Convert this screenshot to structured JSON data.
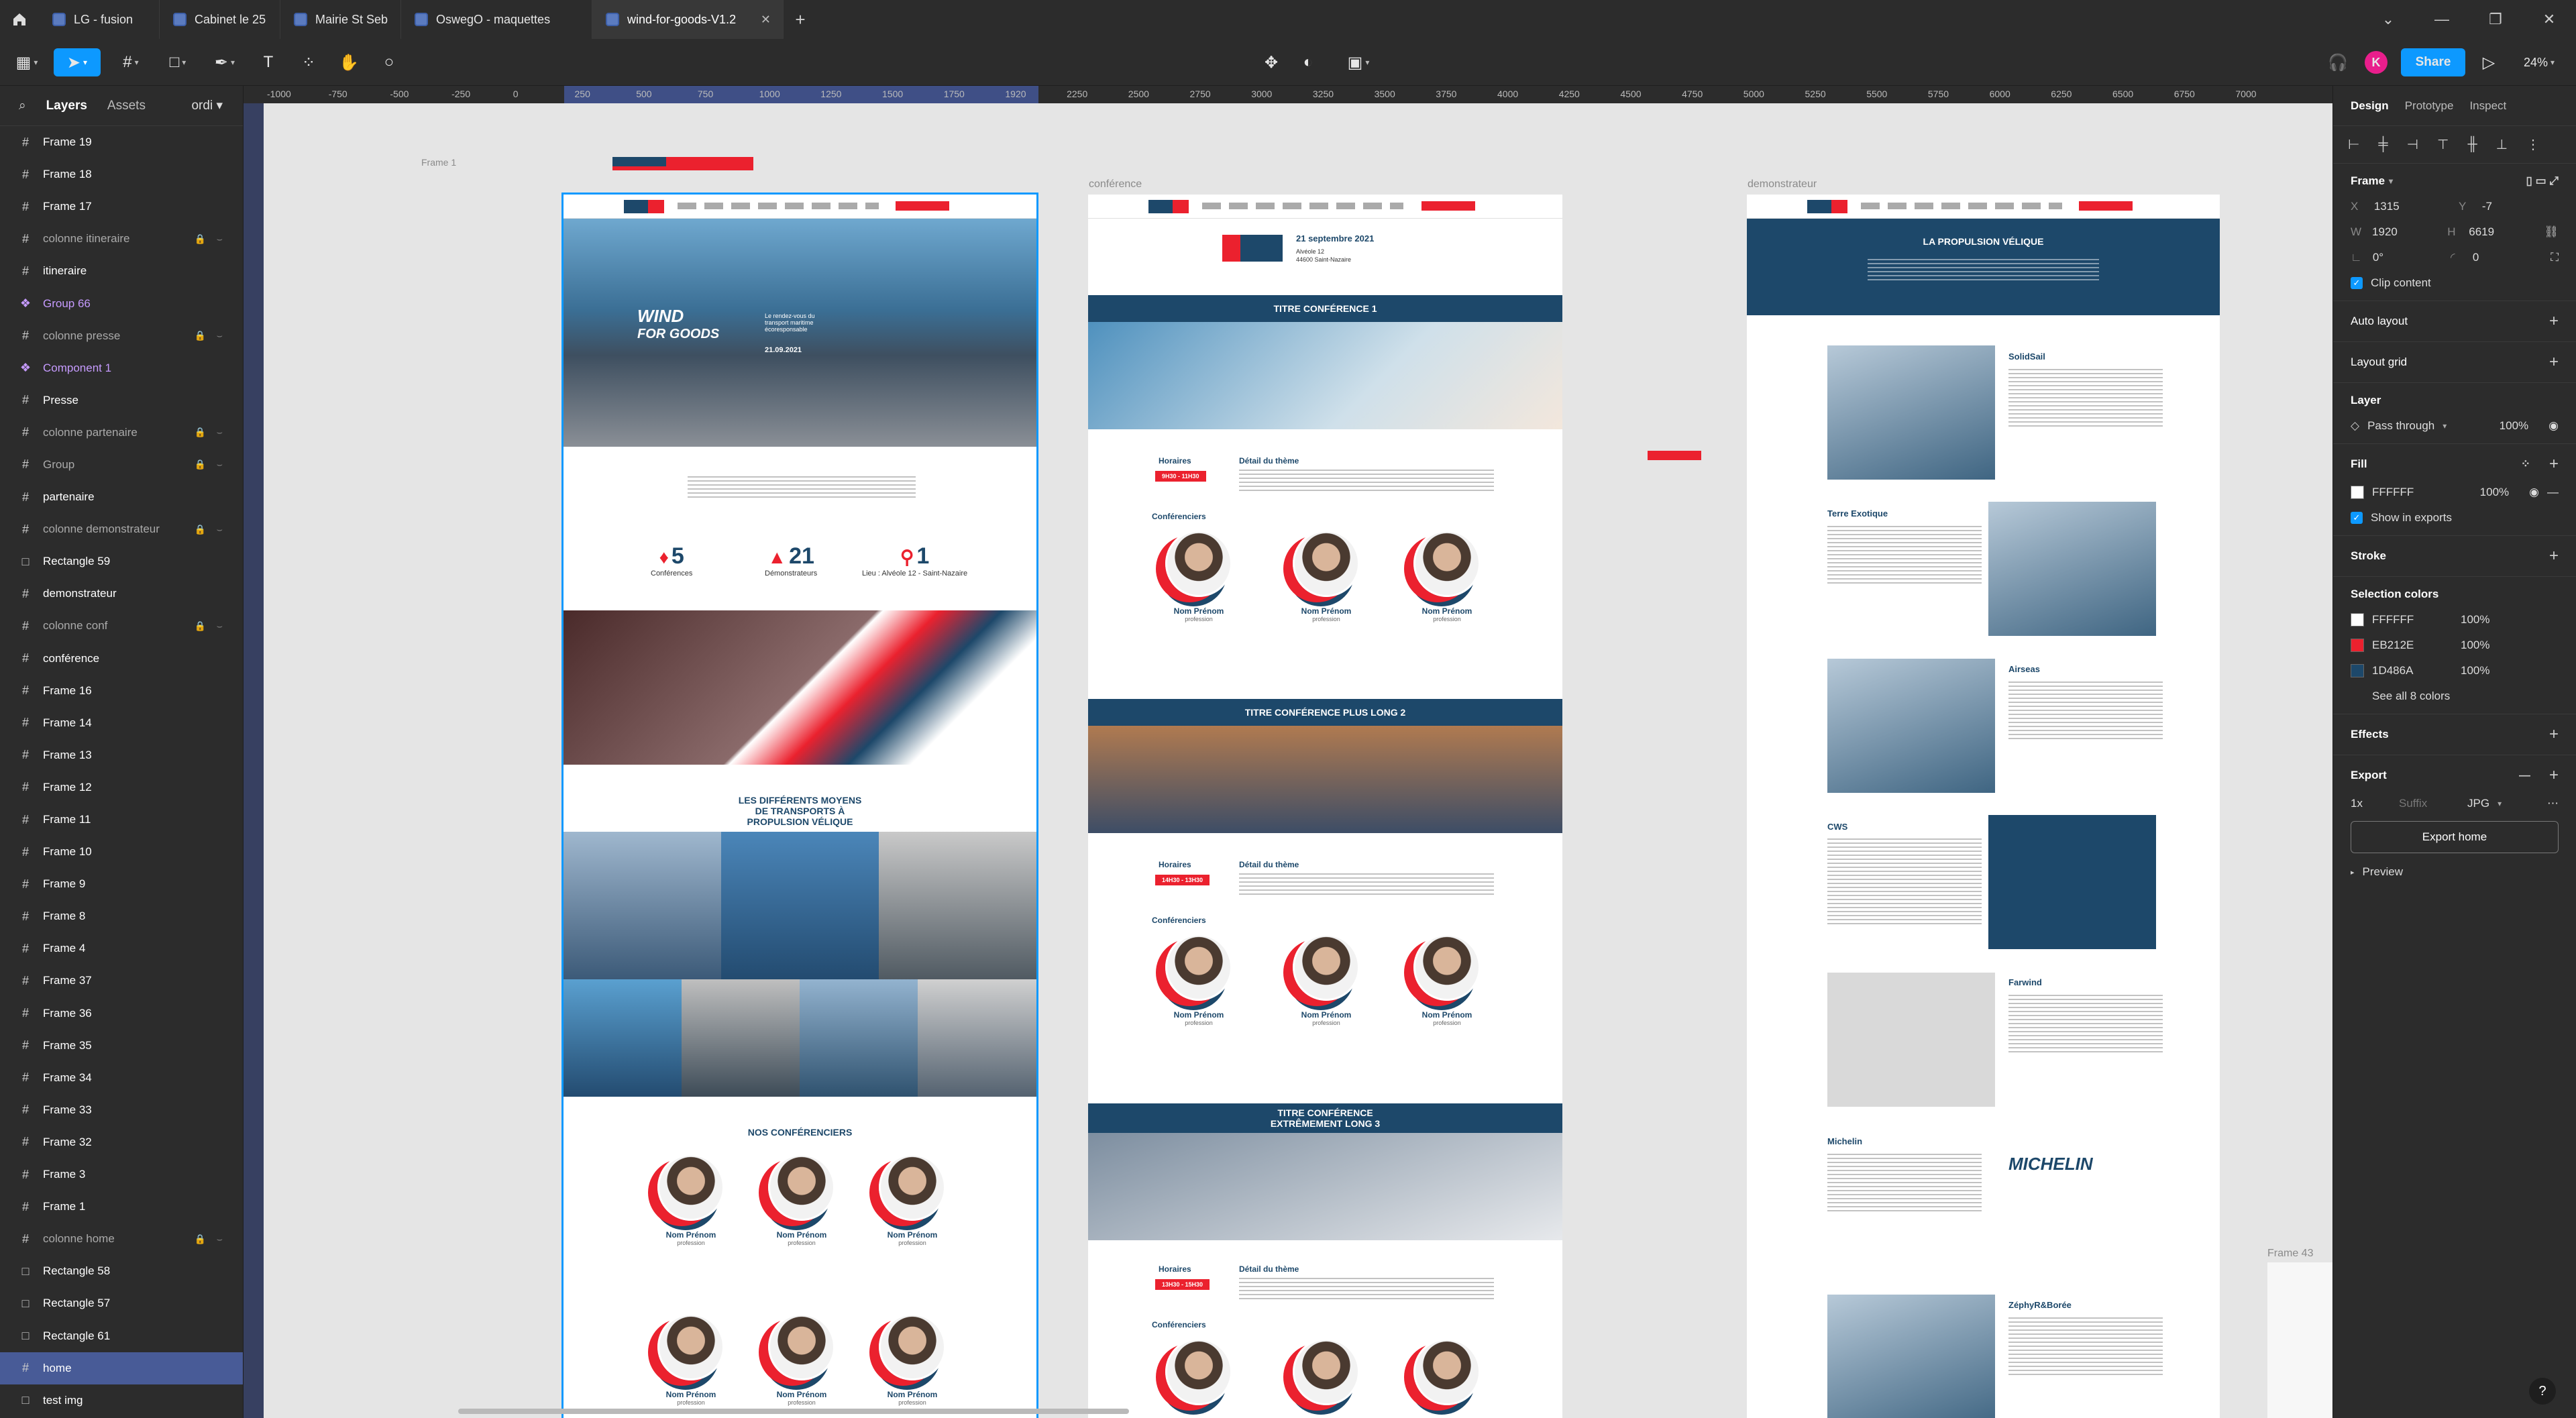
{
  "tabs": [
    {
      "label": "LG - fusion"
    },
    {
      "label": "Cabinet le 25"
    },
    {
      "label": "Mairie St Seb"
    },
    {
      "label": "OswegO - maquettes"
    },
    {
      "label": "wind-for-goods-V1.2"
    }
  ],
  "toolbar": {
    "zoom": "24%",
    "share_label": "Share",
    "avatar_initial": "K"
  },
  "left_panel": {
    "tab_layers": "Layers",
    "tab_assets": "Assets",
    "page": "ordi",
    "layers": [
      {
        "label": "Frame 19",
        "icon": "frame-icon",
        "state": "normal"
      },
      {
        "label": "Frame 18",
        "icon": "frame-icon",
        "state": "normal"
      },
      {
        "label": "Frame 17",
        "icon": "frame-icon",
        "state": "normal"
      },
      {
        "label": "colonne itineraire",
        "icon": "frame-icon",
        "state": "hidden"
      },
      {
        "label": "itineraire",
        "icon": "frame-icon",
        "state": "normal"
      },
      {
        "label": "Group 66",
        "icon": "component-icon",
        "state": "component"
      },
      {
        "label": "colonne presse",
        "icon": "frame-icon",
        "state": "hidden"
      },
      {
        "label": "Component 1",
        "icon": "component-icon",
        "state": "component"
      },
      {
        "label": "Presse",
        "icon": "frame-icon",
        "state": "normal"
      },
      {
        "label": "colonne partenaire",
        "icon": "frame-icon",
        "state": "hidden"
      },
      {
        "label": "Group",
        "icon": "frame-icon",
        "state": "hidden"
      },
      {
        "label": "partenaire",
        "icon": "frame-icon",
        "state": "normal"
      },
      {
        "label": "colonne demonstrateur",
        "icon": "frame-icon",
        "state": "hidden"
      },
      {
        "label": "Rectangle 59",
        "icon": "rect-icon",
        "state": "normal"
      },
      {
        "label": "demonstrateur",
        "icon": "frame-icon",
        "state": "normal"
      },
      {
        "label": "colonne conf",
        "icon": "frame-icon",
        "state": "hidden"
      },
      {
        "label": "conférence",
        "icon": "frame-icon",
        "state": "normal"
      },
      {
        "label": "Frame 16",
        "icon": "frame-icon",
        "state": "normal"
      },
      {
        "label": "Frame 14",
        "icon": "frame-icon",
        "state": "normal"
      },
      {
        "label": "Frame 13",
        "icon": "frame-icon",
        "state": "normal"
      },
      {
        "label": "Frame 12",
        "icon": "frame-icon",
        "state": "normal"
      },
      {
        "label": "Frame 11",
        "icon": "frame-icon",
        "state": "normal"
      },
      {
        "label": "Frame 10",
        "icon": "frame-icon",
        "state": "normal"
      },
      {
        "label": "Frame 9",
        "icon": "frame-icon",
        "state": "normal"
      },
      {
        "label": "Frame 8",
        "icon": "frame-icon",
        "state": "normal"
      },
      {
        "label": "Frame 4",
        "icon": "frame-icon",
        "state": "normal"
      },
      {
        "label": "Frame 37",
        "icon": "frame-icon",
        "state": "normal"
      },
      {
        "label": "Frame 36",
        "icon": "frame-icon",
        "state": "normal"
      },
      {
        "label": "Frame 35",
        "icon": "frame-icon",
        "state": "normal"
      },
      {
        "label": "Frame 34",
        "icon": "frame-icon",
        "state": "normal"
      },
      {
        "label": "Frame 33",
        "icon": "frame-icon",
        "state": "normal"
      },
      {
        "label": "Frame 32",
        "icon": "frame-icon",
        "state": "normal"
      },
      {
        "label": "Frame 3",
        "icon": "frame-icon",
        "state": "normal"
      },
      {
        "label": "Frame 1",
        "icon": "frame-icon",
        "state": "normal"
      },
      {
        "label": "colonne home",
        "icon": "frame-icon",
        "state": "hidden"
      },
      {
        "label": "Rectangle 58",
        "icon": "rect-icon",
        "state": "normal"
      },
      {
        "label": "Rectangle 57",
        "icon": "rect-icon",
        "state": "normal"
      },
      {
        "label": "Rectangle 61",
        "icon": "rect-icon",
        "state": "normal"
      },
      {
        "label": "home",
        "icon": "frame-icon",
        "state": "selected"
      },
      {
        "label": "test img",
        "icon": "rect-icon",
        "state": "normal"
      }
    ]
  },
  "ruler": {
    "ticks": [
      "-1000",
      "-750",
      "-500",
      "-250",
      "0",
      "250",
      "500",
      "750",
      "1000",
      "1250",
      "1500",
      "1750",
      "1920",
      "2250",
      "2500",
      "2750",
      "3000",
      "3250",
      "3500",
      "3750",
      "4000",
      "4250",
      "4500",
      "4750",
      "5000",
      "5250",
      "5500",
      "5750",
      "6000",
      "6250",
      "6500",
      "6750",
      "7000"
    ]
  },
  "canvas": {
    "frames": [
      {
        "label": "Frame 1"
      },
      {
        "label": "conférence"
      },
      {
        "label": "demonstrateur"
      },
      {
        "label": "Frame 43"
      }
    ],
    "home": {
      "hero_date": "21.09.2021",
      "hero_tag": "Le rendez-vous du transport maritime écoresponsable",
      "stats": [
        {
          "value": "5",
          "label": "Conférences"
        },
        {
          "value": "21",
          "label": "Démonstrateurs"
        },
        {
          "value": "1",
          "label": "Lieu : Alvéole 12 - Saint-Nazaire"
        }
      ],
      "section_transports": "LES DIFFÉRENTS MOYENS DE TRANSPORTS À PROPULSION VÉLIQUE",
      "section_speakers": "NOS CONFÉRENCIERS",
      "person_name": "Nom Prénom",
      "person_role": "profession"
    },
    "conference": {
      "date": "21 septembre 2021",
      "place_1": "Alvéole 12",
      "place_2": "44600 Saint-Nazaire",
      "titles": [
        "TITRE CONFÉRENCE 1",
        "TITRE CONFÉRENCE PLUS LONG 2",
        "TITRE CONFÉRENCE EXTRÊMEMENT LONG 3"
      ],
      "hours_label": "Horaires",
      "theme_label": "Détail du thème",
      "hours": [
        "9H30 - 11H30",
        "14H30 - 13H30",
        "13H30 - 15H30"
      ],
      "speakers_label": "Conférenciers"
    },
    "demo": {
      "title": "LA PROPULSION VÉLIQUE",
      "items": [
        "SolidSail",
        "Terre Exotique",
        "Airseas",
        "CWS",
        "Farwind",
        "Michelin",
        "ZéphyR&Borée"
      ],
      "michelin_logo": "MICHELIN"
    }
  },
  "right_panel": {
    "tab_design": "Design",
    "tab_prototype": "Prototype",
    "tab_inspect": "Inspect",
    "frame_label": "Frame",
    "x": "1315",
    "y": "-7",
    "w": "1920",
    "h": "6619",
    "rotation": "0°",
    "radius": "0",
    "clip_content": "Clip content",
    "auto_layout": "Auto layout",
    "layout_grid": "Layout grid",
    "layer": "Layer",
    "blend": "Pass through",
    "layer_opacity": "100%",
    "fill": "Fill",
    "fill_hex": "FFFFFF",
    "fill_opacity": "100%",
    "show_exports": "Show in exports",
    "stroke": "Stroke",
    "selection_colors": "Selection colors",
    "colors": [
      {
        "hex": "FFFFFF",
        "swatch": "#FFFFFF",
        "opacity": "100%"
      },
      {
        "hex": "EB212E",
        "swatch": "#EB212E",
        "opacity": "100%"
      },
      {
        "hex": "1D486A",
        "swatch": "#1D486A",
        "opacity": "100%"
      }
    ],
    "see_all": "See all 8 colors",
    "effects": "Effects",
    "export": "Export",
    "export_scale": "1x",
    "export_suffix": "Suffix",
    "export_format": "JPG",
    "export_button": "Export home",
    "preview": "Preview"
  }
}
